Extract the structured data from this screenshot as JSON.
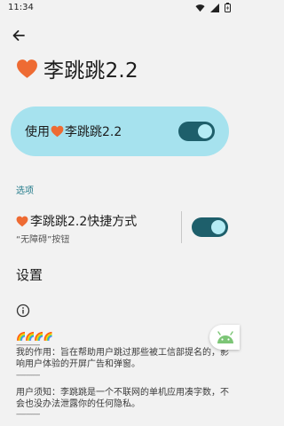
{
  "status_bar": {
    "time": "11:34",
    "icons": [
      "wifi-icon",
      "cell-signal-icon",
      "battery-icon"
    ]
  },
  "header": {
    "back_icon": "arrow-left-icon",
    "title": "李跳跳2.2",
    "title_icon": "heart-icon"
  },
  "master_toggle": {
    "label": "使用",
    "app_name": "李跳跳2.2",
    "checked": true
  },
  "options_section": {
    "label": "选项",
    "shortcut": {
      "title": "李跳跳2.2快捷方式",
      "subtitle": "“无障碍”按钮",
      "checked": true
    }
  },
  "settings": {
    "title": "设置",
    "info_icon": "info-icon",
    "emoji_decoration": "🌈🌈🌈🌈",
    "dash_line": "--------------",
    "purpose": "我的作用：旨在帮助用户跳过那些被工信部提名的，影响用户体验的开屏广告和弹窗。",
    "notice": "用户须知：李跳跳是一个不联网的单机应用凑字数，不会也没办法泄露你的任何隐私。"
  },
  "colors": {
    "accent": "#217a8a",
    "card_bg": "#a6e2ee",
    "switch_track": "#1e5f6b",
    "heart": "#ee6b33",
    "android": "#7cc576"
  },
  "floating_icon": "android-icon"
}
